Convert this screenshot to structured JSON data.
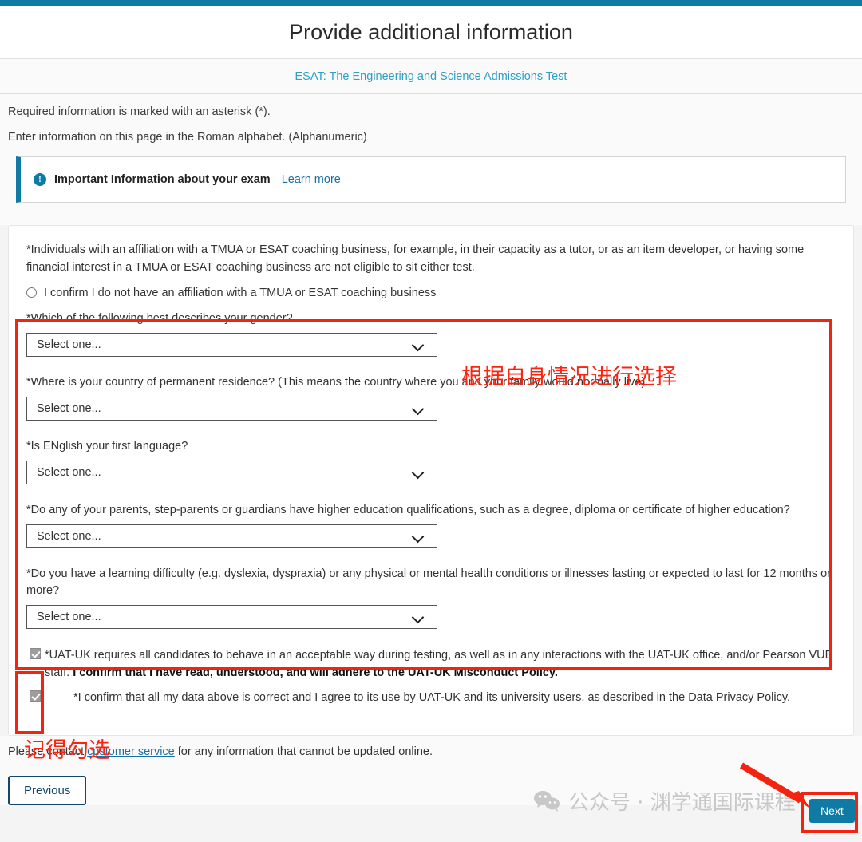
{
  "theme": {
    "accent": "#0f7ba5",
    "link": "#1a6fa8",
    "annotation_red": "#f42310",
    "watermark_gray": "#c8c8c8"
  },
  "header": {
    "title": "Provide additional information",
    "subtitle_link": "ESAT: The Engineering and Science Admissions Test"
  },
  "intro": {
    "required_note": "Required information is marked with an asterisk (*).",
    "alphabet_note": "Enter information on this page in the Roman alphabet. (Alphanumeric)"
  },
  "banner": {
    "icon": "info-circle-icon",
    "text": "Important Information about your exam",
    "link_label": "Learn more"
  },
  "form": {
    "affiliation_text": "*Individuals with an affiliation with a TMUA or ESAT coaching business, for example, in their capacity as a tutor, or as an item developer, or having some financial interest in a TMUA or ESAT coaching business are not eligible to sit either test.",
    "affiliation_radio_label": "I confirm I do not have an affiliation with a TMUA or ESAT coaching business",
    "affiliation_radio_checked": false,
    "questions": [
      {
        "label": "*Which of the following best describes your gender?",
        "value": "Select one..."
      },
      {
        "label": "*Where is your country of permanent residence? (This means the country where you and your family would normally live).",
        "value": "Select one..."
      },
      {
        "label": "*Is ENglish your first language?",
        "value": "Select one..."
      },
      {
        "label": "*Do any of your parents, step-parents or guardians have higher education qualifications, such as a degree, diploma or certificate of higher education?",
        "value": "Select one..."
      },
      {
        "label": "*Do you have a learning difficulty (e.g. dyslexia, dyspraxia) or any physical or mental health conditions or illnesses lasting or expected to last for 12 months or more?",
        "value": "Select one..."
      }
    ],
    "checkboxes": [
      {
        "checked": true,
        "text_plain": "*UAT-UK requires all candidates to behave in an acceptable way during testing, as well as in any interactions with the UAT-UK office, and/or Pearson VUE staff. ",
        "text_bold": "I confirm that I have read, understood, and will adhere to the UAT-UK Misconduct Policy."
      },
      {
        "checked": true,
        "text_plain": "*I confirm that all my data above is correct and I agree to its use by UAT-UK and its university users, as described in the Data Privacy Policy.",
        "text_bold": ""
      }
    ]
  },
  "footer": {
    "contact_prefix": "Please contact ",
    "contact_link": "customer service",
    "contact_suffix": " for any information that cannot be updated online.",
    "previous_label": "Previous",
    "next_label": "Next"
  },
  "annotations": {
    "select_note": "根据自身情况进行选择",
    "check_note": "记得勾选"
  },
  "watermark": {
    "icon": "wechat-icon",
    "text": "公众号 · 渊学通国际课程"
  }
}
